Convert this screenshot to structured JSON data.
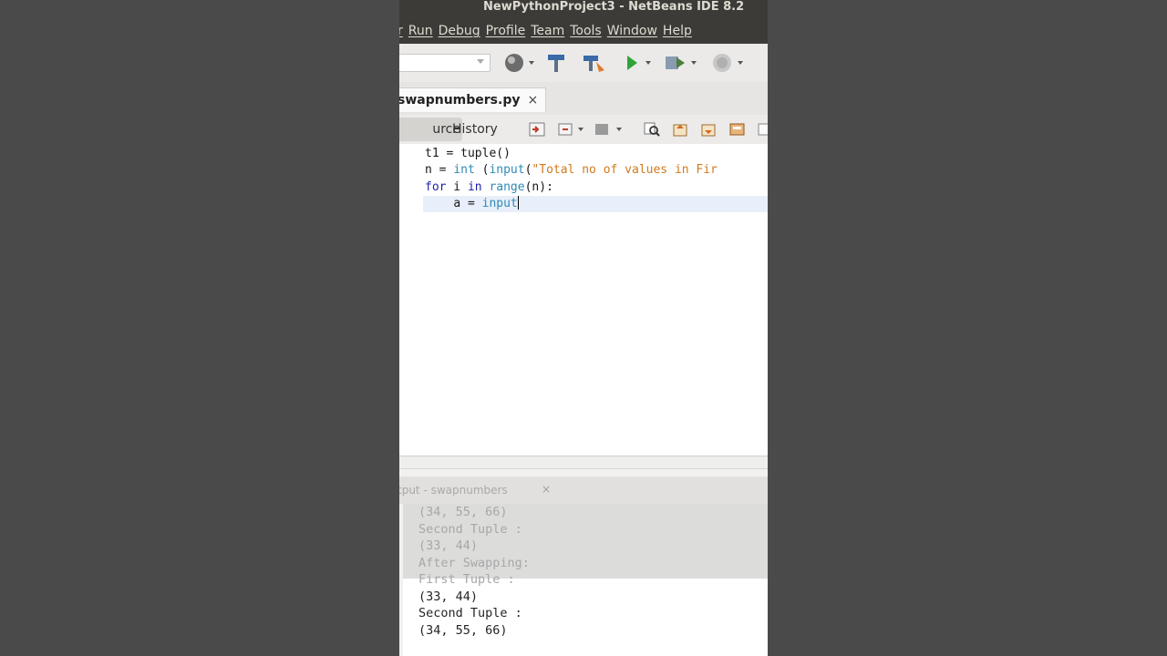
{
  "window": {
    "title": "NewPythonProject3 - NetBeans IDE 8.2"
  },
  "menu": [
    "r",
    "Run",
    "Debug",
    "Profile",
    "Team",
    "Tools",
    "Window",
    "Help"
  ],
  "editor_tab": {
    "filename": "swapnumbers.py",
    "close": "×"
  },
  "editor_toolbar": {
    "source_label": "urce",
    "history_label": "History"
  },
  "code": [
    {
      "text": "t1 = tuple()"
    },
    {
      "pre": "n = ",
      "k1": "int",
      "mid": " (",
      "k2": "input",
      "p": "(",
      "s": "\"Total no of values in Fir"
    },
    {
      "f": "for",
      "a": " i ",
      "in": "in",
      "sp": " ",
      "r": "range",
      "rest": "(n):"
    },
    {
      "indent": "    ",
      "a": "a",
      "eq": " = ",
      "fn": "input"
    }
  ],
  "output_panel": {
    "title": "tput - swapnumbers",
    "close": "×",
    "lines": [
      "(34, 55, 66)",
      "Second Tuple :",
      "(33, 44)",
      "After Swapping:",
      "First Tuple :",
      "(33, 44)",
      "Second Tuple :",
      "(34, 55, 66)"
    ]
  },
  "icons": [
    "globe-icon",
    "hammer-icon",
    "clean-build-icon",
    "run-icon",
    "debug-icon",
    "profile-icon",
    "find-icon",
    "prev-occurrence-icon",
    "next-occurrence-icon",
    "toggle-bookmark-icon"
  ]
}
